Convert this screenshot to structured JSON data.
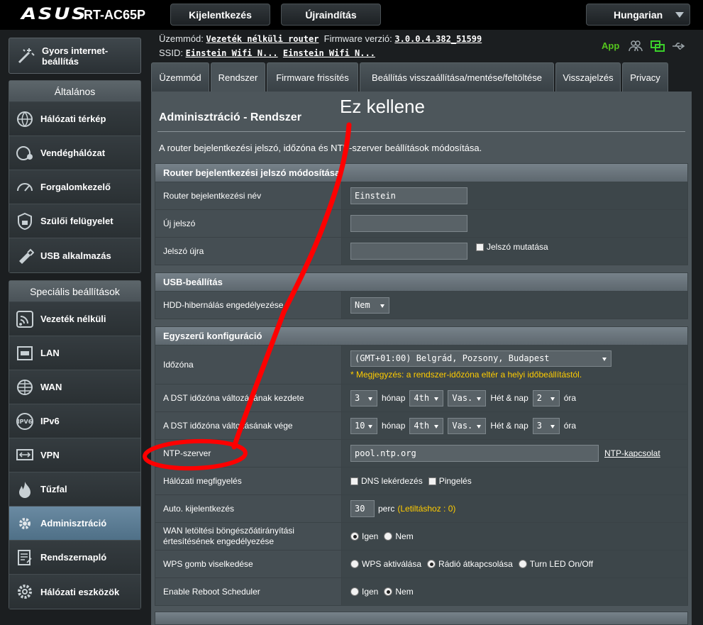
{
  "header": {
    "logo": "ASUS",
    "model": "RT-AC65P",
    "logout_label": "Kijelentkezés",
    "reboot_label": "Újraindítás",
    "language": "Hungarian"
  },
  "info": {
    "mode_label": "Üzemmód:",
    "mode_value": "Vezeték nélküli router",
    "fw_label": "Firmware verzió:",
    "fw_value": "3.0.0.4.382_51599",
    "ssid_label": "SSID:",
    "ssid1": "Einstein Wifi N...",
    "ssid2": "Einstein Wifi N...",
    "app_label": "App"
  },
  "sidebar": {
    "quick_setup": "Gyors internet-\nbeállítás",
    "general_header": "Általános",
    "general_items": [
      "Hálózati térkép",
      "Vendéghálózat",
      "Forgalomkezelő",
      "Szülői felügyelet",
      "USB alkalmazás"
    ],
    "advanced_header": "Speciális beállítások",
    "advanced_items": [
      "Vezeték nélküli",
      "LAN",
      "WAN",
      "IPv6",
      "VPN",
      "Tűzfal",
      "Adminisztráció",
      "Rendszernapló",
      "Hálózati eszközök"
    ],
    "active_item": "Adminisztráció"
  },
  "tabs": [
    "Üzemmód",
    "Rendszer",
    "Firmware frissítés",
    "Beállítás visszaállítása/mentése/feltöltése",
    "Visszajelzés",
    "Privacy"
  ],
  "active_tab": "Rendszer",
  "page": {
    "title": "Adminisztráció - Rendszer",
    "description": "A router bejelentkezési jelszó, időzóna és NTP-szerver beállítások módosítása."
  },
  "sections": {
    "login": {
      "header": "Router bejelentkezési jelszó módosítása",
      "name_label": "Router bejelentkezési név",
      "name_value": "Einstein",
      "new_pw_label": "Új jelszó",
      "repeat_pw_label": "Jelszó újra",
      "show_pw_label": "Jelszó mutatása"
    },
    "usb": {
      "header": "USB-beállítás",
      "hdd_label": "HDD-hibernálás engedélyezése",
      "hdd_value": "Nem"
    },
    "basic": {
      "header": "Egyszerű konfiguráció",
      "tz_label": "Időzóna",
      "tz_value": "(GMT+01:00) Belgrád, Pozsony, Budapest",
      "tz_note": "* Megjegyzés: a rendszer-időzóna eltér a helyi időbeállítástól.",
      "dst_start_label": "A DST időzóna változásának kezdete",
      "dst_start": {
        "month": "3",
        "week": "4th",
        "day": "Vas.",
        "hour": "2"
      },
      "dst_end_label": "A DST időzóna változásának vége",
      "dst_end": {
        "month": "10",
        "week": "4th",
        "day": "Vas.",
        "hour": "3"
      },
      "month_unit": "hónap",
      "week_day_unit": "Hét & nap",
      "hour_unit": "óra",
      "ntp_label": "NTP-szerver",
      "ntp_value": "pool.ntp.org",
      "ntp_link": "NTP-kapcsolat",
      "netmon_label": "Hálózati megfigyelés",
      "dns_query": "DNS lekérdezés",
      "ping": "Pingelés",
      "autologout_label": "Auto. kijelentkezés",
      "autologout_value": "30",
      "autologout_unit": "perc",
      "autologout_note": "(Letiltáshoz : 0)",
      "wan_redirect_label": "WAN letöltési böngészőátirányítási értesítésének engedélyezése",
      "yes": "Igen",
      "no": "Nem",
      "wps_label": "WPS gomb viselkedése",
      "wps_opt1": "WPS aktiválása",
      "wps_opt2": "Rádió átkapcsolása",
      "wps_opt3": "Turn LED On/Off",
      "reboot_sched_label": "Enable Reboot Scheduler"
    }
  },
  "annotation": {
    "text": "Ez kellene",
    "color": "#ff0000"
  }
}
